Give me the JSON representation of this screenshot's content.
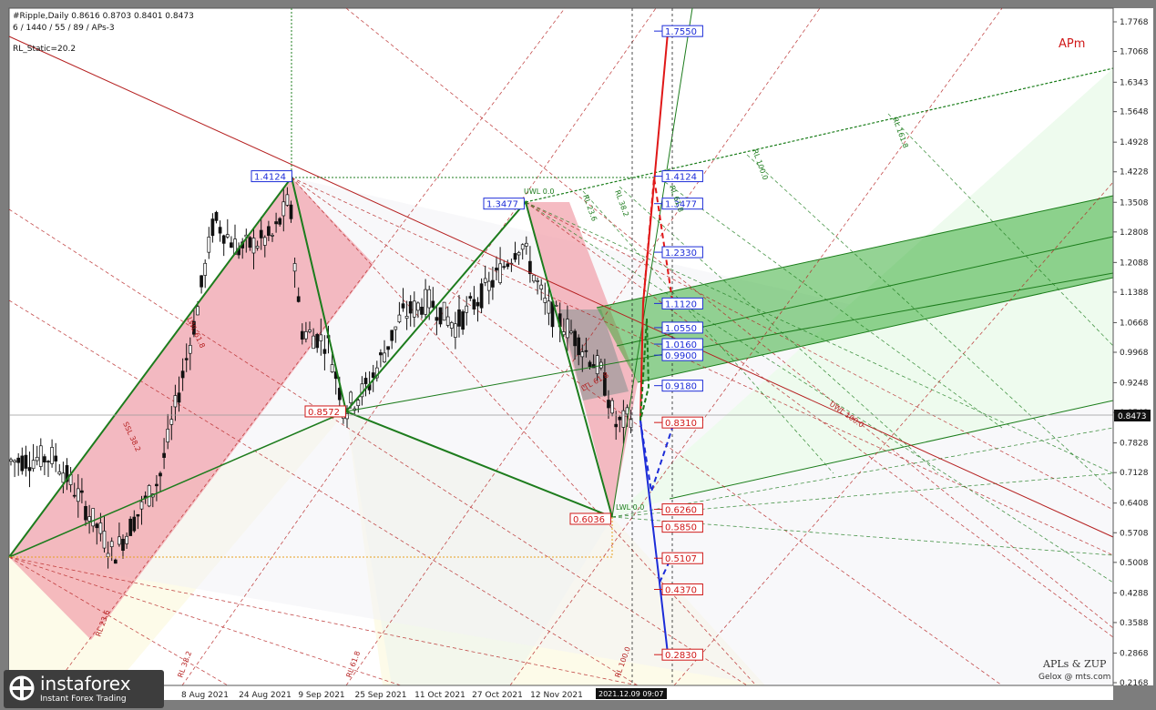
{
  "header": {
    "symbol_line": "#Ripple,Daily  0.8616 0.8703 0.8401 0.8473",
    "params_line": "6 / 1440 / 55 / 89 / APs-3",
    "rl_static": "RL_Static=20.2"
  },
  "brand_tag": "APm",
  "footer": {
    "credit1": "APLs & ZUP",
    "credit2": "Gelox @ mts.com",
    "date_cursor": "2021.12.09 09:07",
    "logo_name": "instaforex",
    "logo_sub": "Instant Forex Trading"
  },
  "colors": {
    "up_cloud": "#2a9c2a",
    "down_cloud": "#f2a4ad",
    "bull_line": "#e01818",
    "bear_line": "#1c2cd8",
    "bg": "#ffffff"
  },
  "chart_data": {
    "type": "candlestick",
    "title": "#Ripple,Daily",
    "ohlc_last": {
      "open": 0.8616,
      "high": 0.8703,
      "low": 0.8401,
      "close": 0.8473
    },
    "current_price": "0.8473",
    "y_ticks": [
      "1.7768",
      "1.7068",
      "1.6343",
      "1.5648",
      "1.4928",
      "1.4228",
      "1.3508",
      "1.2808",
      "1.2088",
      "1.1388",
      "1.0668",
      "0.9968",
      "0.9248",
      "0.8548",
      "0.7828",
      "0.7128",
      "0.6408",
      "0.5708",
      "0.5008",
      "0.4288",
      "0.3588",
      "0.2868",
      "0.2168"
    ],
    "x_ticks": [
      "8 Aug 2021",
      "24 Aug 2021",
      "9 Sep 2021",
      "25 Sep 2021",
      "11 Oct 2021",
      "27 Oct 2021",
      "12 Nov 2021"
    ],
    "price_range": [
      0.2168,
      1.7768
    ],
    "wave_points": [
      {
        "label": "1.4124",
        "price": 1.4124
      },
      {
        "label": "0.8572",
        "price": 0.8572
      },
      {
        "label": "1.3477",
        "price": 1.3477
      },
      {
        "label": "0.6036",
        "price": 0.6036
      }
    ],
    "target_levels_up": [
      {
        "label": "1.7550",
        "value": 1.755
      },
      {
        "label": "1.4124",
        "value": 1.4124
      },
      {
        "label": "1.3477",
        "value": 1.3477
      },
      {
        "label": "1.2330",
        "value": 1.233
      },
      {
        "label": "1.1120",
        "value": 1.112
      },
      {
        "label": "1.0550",
        "value": 1.055
      },
      {
        "label": "1.0160",
        "value": 1.016
      },
      {
        "label": "0.9900",
        "value": 0.99
      },
      {
        "label": "0.9180",
        "value": 0.918
      }
    ],
    "target_levels_down": [
      {
        "label": "0.8310",
        "value": 0.831
      },
      {
        "label": "0.6260",
        "value": 0.626
      },
      {
        "label": "0.5850",
        "value": 0.585
      },
      {
        "label": "0.5107",
        "value": 0.5107
      },
      {
        "label": "0.4370",
        "value": 0.437
      },
      {
        "label": "0.2830",
        "value": 0.283
      }
    ],
    "fib_labels": [
      "UWL 0.0",
      "RL 23.6",
      "RL 38.2",
      "RL 61.8",
      "RL 100.0",
      "RL 161.8",
      "UWL 100.0",
      "LWL 0.0",
      "RL 23.6",
      "RL 38.2",
      "RL 61.8",
      "RL 100.0",
      "LTL 61.8",
      "SSL 38.2",
      "LWL 61.8"
    ]
  }
}
